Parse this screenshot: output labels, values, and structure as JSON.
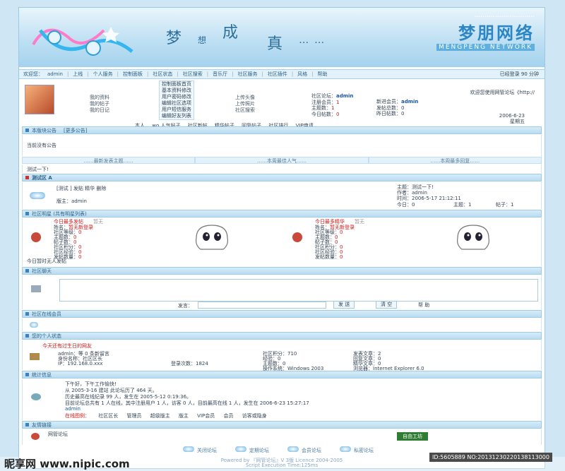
{
  "header": {
    "slogan": [
      "梦",
      "想",
      "成",
      "真",
      "……"
    ],
    "brand_cn": "梦朋网络",
    "brand_en": "MENGPENG NETWORK"
  },
  "nav": {
    "items": [
      "欢迎您：",
      "admin",
      "上线",
      "个人服务",
      "控制面板",
      "社区状态",
      "社区搜索",
      "音乐厅",
      "社区服务",
      "社区插件",
      "风格",
      "帮助"
    ],
    "right": "已经登录 90 分钟"
  },
  "user": {
    "links_a": [
      "我的资料",
      "我的帖子",
      "我的日记"
    ],
    "control": [
      "控制面板首页",
      "基本资料修改",
      "用户密码修改",
      "编辑社区选项",
      "用户短信服务",
      "编辑好友列表"
    ],
    "links_b": [
      "上传头像",
      "上传照片",
      "社区搜索"
    ],
    "welcome": "欢迎您使用网管论坛《http://",
    "info_labels": [
      "社区论坛：",
      "注册会员：",
      "主题数：",
      "今日帖数：",
      "今日新帖：",
      "发帖总数：",
      "昨日帖数："
    ],
    "info_values": [
      "admin",
      "1",
      "1",
      "0",
      "0",
      "0",
      "0"
    ],
    "newest_label": "新进会员：",
    "newest_value": "admin",
    "date": "2006-6-23",
    "weekday": "星期五",
    "quick_links": [
      "本人",
      "wo 人气帖子",
      "社区新帖",
      "精华帖子",
      "回复帖子",
      "社区排行",
      "VIP申请"
    ]
  },
  "announce": {
    "bar": "本版块公告",
    "bar_extra": "[更多公告]",
    "text": "当前没有公告"
  },
  "tri_header": [
    "……最新发表主题……",
    "……本周最佳人气……",
    "……本周最多回复……"
  ],
  "topic_bar": "测试一下!",
  "forum": {
    "bar": "测试区 A",
    "title": "[测试 ] 发贴 精华 删除",
    "moderator": "版主：admin",
    "right_lines": [
      "主题：测试一下!",
      "作者：admin",
      "时间：2006-5-17 21:12:11"
    ],
    "stats": [
      "今日：0",
      "主题：1",
      "帖子：1"
    ]
  },
  "stars": {
    "bar": "社区明星 (共有明星列表)",
    "left_title": "今日最多发帖",
    "left_sub": "暂无",
    "right_title": "今日最多精华",
    "right_sub": "暂无",
    "labels": [
      "姓名：",
      "社区等级：",
      "主题数：",
      "帖子数：",
      "社区积分：",
      "社区经验：",
      "发帖数量："
    ],
    "values": [
      "暂无新登录",
      "0",
      "0",
      "0",
      "0",
      "0",
      "0"
    ],
    "note": "今日暂时无人发帖"
  },
  "chat": {
    "bar": "社区聊天",
    "say_label": "发言：",
    "send": "发 送",
    "clear": "清 空",
    "help": "帮 助"
  },
  "online": {
    "bar": "社区在线会员"
  },
  "personal": {
    "bar": "您的个人状态",
    "headline": "今天还有过生日的网友",
    "rows": [
      [
        "admin：等 0 条新留言",
        "社区积分：710",
        "发表文章：2"
      ],
      [
        "身份名称：社区区长",
        "经验：0",
        "回复文章：0"
      ],
      [
        "IP：192.168.0.xxx",
        "主题数：0",
        "精华文章：0"
      ],
      [
        "登录次数：1824",
        "操作系统：Windows 2003",
        "浏览器：Internet Explorer 6.0"
      ]
    ]
  },
  "stats": {
    "bar": "统计信息",
    "lines": [
      "下午好，下午工作愉快!",
      "从 2005-3-16 建站 此论坛历了 464 天。",
      "历史最高在线纪录 99 人，发生在 2005-5-12 0:19:36。",
      "目前论坛总共有 1 人在线，其中注册用户 1 人，访客 0 人，目前最高在线 1 人，发生在 2006-6-23 15:27:17",
      "admin"
    ],
    "legend": [
      "在线图例：",
      "社区区长",
      "管理员",
      "超级版主",
      "版主",
      "VIP会员",
      "会员",
      "访客或隐身"
    ]
  },
  "links": {
    "bar": "友情链接",
    "item": "网管论坛",
    "ad": "自由工坊"
  },
  "footer": {
    "buttons": [
      "关闭论坛",
      "定期论坛",
      "会员论坛",
      "私密论坛"
    ],
    "powered": "Powered by 『网管论坛』V 3版 Licence 2004-2005",
    "exec": "Script Execution Time:125ms"
  },
  "watermark": {
    "logo": "昵享网 www.nipic.com",
    "id": "ID:5605889 NO:20131230220138113000"
  }
}
